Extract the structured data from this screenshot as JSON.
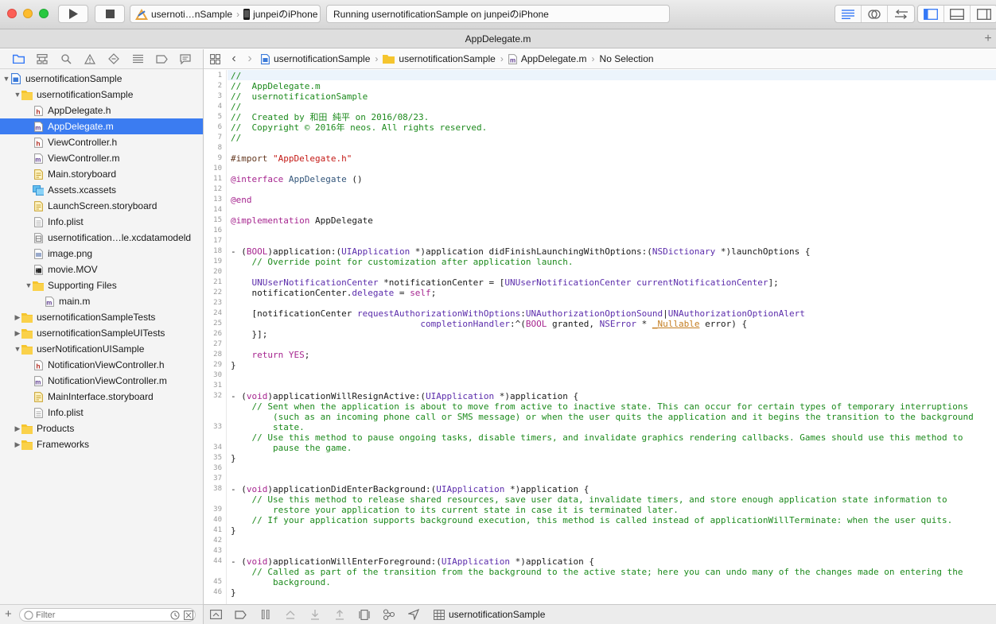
{
  "toolbar": {
    "scheme": {
      "project": "usernoti…nSample",
      "device": "junpeiのiPhone"
    },
    "activity": "Running usernotificationSample on junpeiのiPhone"
  },
  "tab": {
    "title": "AppDelegate.m",
    "plus": "+"
  },
  "navigator": {
    "tree": [
      {
        "label": "usernotificationSample",
        "indent": 0,
        "disc": "open",
        "icon": "project"
      },
      {
        "label": "usernotificationSample",
        "indent": 1,
        "disc": "open",
        "icon": "folder"
      },
      {
        "label": "AppDelegate.h",
        "indent": 2,
        "icon": "h"
      },
      {
        "label": "AppDelegate.m",
        "indent": 2,
        "icon": "m",
        "selected": true
      },
      {
        "label": "ViewController.h",
        "indent": 2,
        "icon": "h"
      },
      {
        "label": "ViewController.m",
        "indent": 2,
        "icon": "m"
      },
      {
        "label": "Main.storyboard",
        "indent": 2,
        "icon": "storyboard"
      },
      {
        "label": "Assets.xcassets",
        "indent": 2,
        "icon": "assets"
      },
      {
        "label": "LaunchScreen.storyboard",
        "indent": 2,
        "icon": "storyboard"
      },
      {
        "label": "Info.plist",
        "indent": 2,
        "icon": "plist"
      },
      {
        "label": "usernotification…le.xcdatamodeld",
        "indent": 2,
        "icon": "datamodel"
      },
      {
        "label": "image.png",
        "indent": 2,
        "icon": "image"
      },
      {
        "label": "movie.MOV",
        "indent": 2,
        "icon": "movie"
      },
      {
        "label": "Supporting Files",
        "indent": 2,
        "disc": "open",
        "icon": "folder"
      },
      {
        "label": "main.m",
        "indent": 3,
        "icon": "m"
      },
      {
        "label": "usernotificationSampleTests",
        "indent": 1,
        "disc": "closed",
        "icon": "folder"
      },
      {
        "label": "usernotificationSampleUITests",
        "indent": 1,
        "disc": "closed",
        "icon": "folder"
      },
      {
        "label": "userNotificationUISample",
        "indent": 1,
        "disc": "open",
        "icon": "folder"
      },
      {
        "label": "NotificationViewController.h",
        "indent": 2,
        "icon": "h"
      },
      {
        "label": "NotificationViewController.m",
        "indent": 2,
        "icon": "m"
      },
      {
        "label": "MainInterface.storyboard",
        "indent": 2,
        "icon": "storyboard"
      },
      {
        "label": "Info.plist",
        "indent": 2,
        "icon": "plist"
      },
      {
        "label": "Products",
        "indent": 1,
        "disc": "closed",
        "icon": "folder"
      },
      {
        "label": "Frameworks",
        "indent": 1,
        "disc": "closed",
        "icon": "folder"
      }
    ],
    "filter_placeholder": "Filter"
  },
  "jumpbar": {
    "crumbs": [
      "usernotificationSample",
      "usernotificationSample",
      "AppDelegate.m",
      "No Selection"
    ]
  },
  "debug": {
    "target": "usernotificationSample"
  },
  "editor": {
    "lines": [
      {
        "n": "1",
        "t": [
          [
            "c",
            "//"
          ]
        ]
      },
      {
        "n": "2",
        "t": [
          [
            "c",
            "//  AppDelegate.m"
          ]
        ]
      },
      {
        "n": "3",
        "t": [
          [
            "c",
            "//  usernotificationSample"
          ]
        ]
      },
      {
        "n": "4",
        "t": [
          [
            "c",
            "//"
          ]
        ]
      },
      {
        "n": "5",
        "t": [
          [
            "c",
            "//  Created by 和田 純平 on 2016/08/23."
          ]
        ]
      },
      {
        "n": "6",
        "t": [
          [
            "c",
            "//  Copyright © 2016年 neos. All rights reserved."
          ]
        ]
      },
      {
        "n": "7",
        "t": [
          [
            "c",
            "//"
          ]
        ]
      },
      {
        "n": "8",
        "t": []
      },
      {
        "n": "9",
        "t": [
          [
            "d",
            "#import "
          ],
          [
            "s",
            "\"AppDelegate.h\""
          ]
        ]
      },
      {
        "n": "10",
        "t": []
      },
      {
        "n": "11",
        "t": [
          [
            "k",
            "@interface"
          ],
          [
            "",
            " "
          ],
          [
            "m",
            "AppDelegate"
          ],
          [
            "",
            " ()"
          ]
        ]
      },
      {
        "n": "12",
        "t": []
      },
      {
        "n": "13",
        "t": [
          [
            "k",
            "@end"
          ]
        ]
      },
      {
        "n": "14",
        "t": []
      },
      {
        "n": "15",
        "t": [
          [
            "k",
            "@implementation"
          ],
          [
            "",
            " AppDelegate"
          ]
        ]
      },
      {
        "n": "16",
        "t": []
      },
      {
        "n": "17",
        "t": []
      },
      {
        "n": "18",
        "t": [
          [
            "",
            "- ("
          ],
          [
            "k",
            "BOOL"
          ],
          [
            "",
            ")application:("
          ],
          [
            "t",
            "UIApplication"
          ],
          [
            "",
            " *)application didFinishLaunchingWithOptions:("
          ],
          [
            "t",
            "NSDictionary"
          ],
          [
            "",
            " *)launchOptions {"
          ]
        ]
      },
      {
        "n": "19",
        "t": [
          [
            "c",
            "    // Override point for customization after application launch."
          ]
        ]
      },
      {
        "n": "20",
        "t": []
      },
      {
        "n": "21",
        "t": [
          [
            "",
            "    "
          ],
          [
            "t",
            "UNUserNotificationCenter"
          ],
          [
            "",
            " *notificationCenter = ["
          ],
          [
            "t",
            "UNUserNotificationCenter"
          ],
          [
            "",
            " "
          ],
          [
            "t",
            "currentNotificationCenter"
          ],
          [
            "",
            "];"
          ]
        ]
      },
      {
        "n": "22",
        "t": [
          [
            "",
            "    notificationCenter."
          ],
          [
            "t",
            "delegate"
          ],
          [
            "",
            " = "
          ],
          [
            "k",
            "self"
          ],
          [
            "",
            ";"
          ]
        ]
      },
      {
        "n": "23",
        "t": []
      },
      {
        "n": "24",
        "t": [
          [
            "",
            "    [notificationCenter "
          ],
          [
            "t",
            "requestAuthorizationWithOptions"
          ],
          [
            "",
            ":"
          ],
          [
            "t",
            "UNAuthorizationOptionSound"
          ],
          [
            "",
            "|"
          ],
          [
            "t",
            "UNAuthorizationOptionAlert"
          ]
        ]
      },
      {
        "n": "25",
        "t": [
          [
            "",
            "                                    "
          ],
          [
            "t",
            "completionHandler"
          ],
          [
            "",
            ":^("
          ],
          [
            "k",
            "BOOL"
          ],
          [
            "",
            " granted, "
          ],
          [
            "t",
            "NSError"
          ],
          [
            "",
            " * "
          ],
          [
            "u",
            "_Nullable"
          ],
          [
            "",
            " error) {"
          ]
        ]
      },
      {
        "n": "26",
        "t": [
          [
            "",
            "    }];"
          ]
        ]
      },
      {
        "n": "27",
        "t": []
      },
      {
        "n": "28",
        "t": [
          [
            "",
            "    "
          ],
          [
            "k",
            "return"
          ],
          [
            "",
            " "
          ],
          [
            "k",
            "YES"
          ],
          [
            "",
            ";"
          ]
        ]
      },
      {
        "n": "29",
        "t": [
          [
            "",
            "}"
          ]
        ]
      },
      {
        "n": "30",
        "t": []
      },
      {
        "n": "31",
        "t": []
      },
      {
        "n": "32",
        "t": [
          [
            "",
            "- ("
          ],
          [
            "k",
            "void"
          ],
          [
            "",
            ")applicationWillResignActive:("
          ],
          [
            "t",
            "UIApplication"
          ],
          [
            "",
            " *)application {"
          ]
        ]
      },
      {
        "n": "",
        "t": [
          [
            "c",
            "    // Sent when the application is about to move from active to inactive state. This can occur for certain types of temporary interruptions"
          ]
        ]
      },
      {
        "n": "",
        "t": [
          [
            "c",
            "        (such as an incoming phone call or SMS message) or when the user quits the application and it begins the transition to the background"
          ]
        ]
      },
      {
        "n": "33",
        "t": [
          [
            "c",
            "        state."
          ]
        ]
      },
      {
        "n": "",
        "t": [
          [
            "c",
            "    // Use this method to pause ongoing tasks, disable timers, and invalidate graphics rendering callbacks. Games should use this method to"
          ]
        ]
      },
      {
        "n": "34",
        "t": [
          [
            "c",
            "        pause the game."
          ]
        ]
      },
      {
        "n": "35",
        "t": [
          [
            "",
            "}"
          ]
        ]
      },
      {
        "n": "36",
        "t": []
      },
      {
        "n": "37",
        "t": []
      },
      {
        "n": "38",
        "t": [
          [
            "",
            "- ("
          ],
          [
            "k",
            "void"
          ],
          [
            "",
            ")applicationDidEnterBackground:("
          ],
          [
            "t",
            "UIApplication"
          ],
          [
            "",
            " *)application {"
          ]
        ]
      },
      {
        "n": "",
        "t": [
          [
            "c",
            "    // Use this method to release shared resources, save user data, invalidate timers, and store enough application state information to"
          ]
        ]
      },
      {
        "n": "39",
        "t": [
          [
            "c",
            "        restore your application to its current state in case it is terminated later."
          ]
        ]
      },
      {
        "n": "40",
        "t": [
          [
            "c",
            "    // If your application supports background execution, this method is called instead of applicationWillTerminate: when the user quits."
          ]
        ]
      },
      {
        "n": "41",
        "t": [
          [
            "",
            "}"
          ]
        ]
      },
      {
        "n": "42",
        "t": []
      },
      {
        "n": "43",
        "t": []
      },
      {
        "n": "44",
        "t": [
          [
            "",
            "- ("
          ],
          [
            "k",
            "void"
          ],
          [
            "",
            ")applicationWillEnterForeground:("
          ],
          [
            "t",
            "UIApplication"
          ],
          [
            "",
            " *)application {"
          ]
        ]
      },
      {
        "n": "",
        "t": [
          [
            "c",
            "    // Called as part of the transition from the background to the active state; here you can undo many of the changes made on entering the"
          ]
        ]
      },
      {
        "n": "45",
        "t": [
          [
            "c",
            "        background."
          ]
        ]
      },
      {
        "n": "46",
        "t": [
          [
            "",
            "}"
          ]
        ]
      }
    ]
  }
}
